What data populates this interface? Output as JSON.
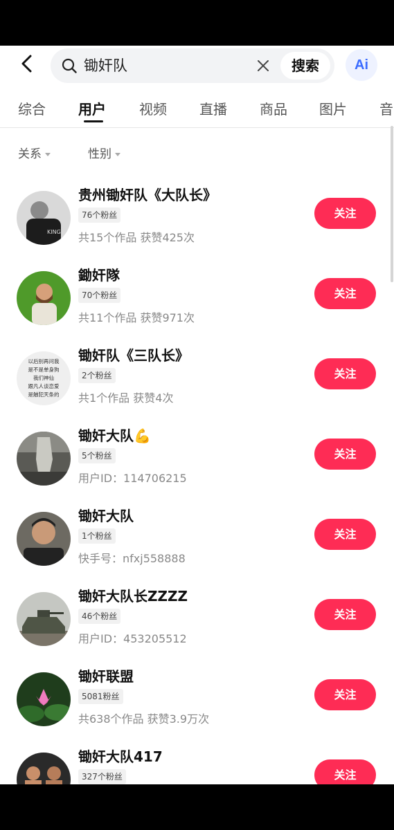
{
  "header": {
    "search_query": "锄奸队",
    "search_button": "搜索",
    "ai_label": "Ai"
  },
  "tabs": [
    {
      "label": "综合"
    },
    {
      "label": "用户"
    },
    {
      "label": "视频"
    },
    {
      "label": "直播"
    },
    {
      "label": "商品"
    },
    {
      "label": "图片"
    },
    {
      "label": "音"
    }
  ],
  "active_tab": "用户",
  "filters": [
    {
      "label": "关系"
    },
    {
      "label": "性别"
    }
  ],
  "users": [
    {
      "name": "贵州锄奸队《大队长》",
      "fans": "76个粉丝",
      "meta": "共15个作品 获赞425次",
      "follow": "关注"
    },
    {
      "name": "鋤奸隊",
      "fans": "70个粉丝",
      "meta": "共11个作品 获赞971次",
      "follow": "关注"
    },
    {
      "name": "锄奸队《三队长》",
      "fans": "2个粉丝",
      "meta": "共1个作品 获赞4次",
      "follow": "关注",
      "avatar_text": [
        "以后别再问我",
        "是不是单身狗",
        "我们神仙",
        "跟凡人谈恋爱",
        "是触犯天条的"
      ]
    },
    {
      "name": "锄奸大队💪",
      "fans": "5个粉丝",
      "meta": "用户ID：114706215",
      "follow": "关注"
    },
    {
      "name": "锄奸大队",
      "fans": "1个粉丝",
      "meta": "快手号：nfxj558888",
      "follow": "关注"
    },
    {
      "name": "锄奸大队长ZZZZ",
      "fans": "46个粉丝",
      "meta": "用户ID：453205512",
      "follow": "关注"
    },
    {
      "name": "锄奸联盟",
      "fans": "5081粉丝",
      "meta": "共638个作品 获赞3.9万次",
      "follow": "关注"
    },
    {
      "name": "锄奸大队417",
      "fans": "327个粉丝",
      "meta": "",
      "follow": "关注"
    }
  ],
  "colors": {
    "follow_button": "#fe2c55",
    "ai_accent": "#3b6cff"
  }
}
